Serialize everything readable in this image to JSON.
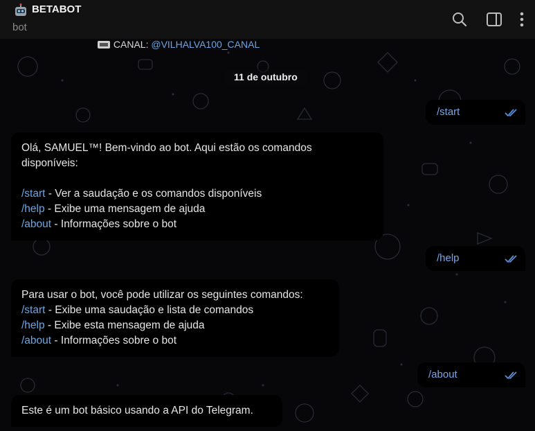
{
  "header": {
    "title": "BETABOT",
    "subtitle": "bot",
    "icons": [
      "search-icon",
      "sidebar-toggle-icon",
      "more-vertical-icon"
    ]
  },
  "pinned": {
    "prefix": "CANAL: ",
    "link": "@VILHALVA100_CANAL"
  },
  "date_separator": "11 de outubro",
  "messages": [
    {
      "type": "outgoing",
      "text": "/start",
      "status": "read"
    },
    {
      "type": "incoming",
      "lines": [
        {
          "plain": "Olá, SAMUEL™! Bem-vindo ao bot. Aqui estão os comandos"
        },
        {
          "plain": "disponíveis:"
        },
        {
          "plain": ""
        },
        {
          "cmd": "/start",
          "rest": " - Ver a saudação e os comandos disponíveis"
        },
        {
          "cmd": "/help",
          "rest": " - Exibe uma mensagem de ajuda"
        },
        {
          "cmd": "/about",
          "rest": " - Informações sobre o bot"
        }
      ]
    },
    {
      "type": "outgoing",
      "text": "/help",
      "status": "read"
    },
    {
      "type": "incoming",
      "lines": [
        {
          "plain": "Para usar o bot, você pode utilizar os seguintes comandos:"
        },
        {
          "cmd": "/start",
          "rest": " - Exibe uma saudação e lista de comandos"
        },
        {
          "cmd": "/help",
          "rest": " - Exibe esta mensagem de ajuda"
        },
        {
          "cmd": "/about",
          "rest": " - Informações sobre o bot"
        }
      ]
    },
    {
      "type": "outgoing",
      "text": "/about",
      "status": "read"
    },
    {
      "type": "incoming",
      "lines": [
        {
          "plain": "Este é um bot básico usando a API do Telegram."
        }
      ]
    }
  ],
  "colors": {
    "link": "#6aa6e6",
    "check": "#5b8fd6",
    "bubble": "#000000",
    "header_bg": "#121212"
  }
}
